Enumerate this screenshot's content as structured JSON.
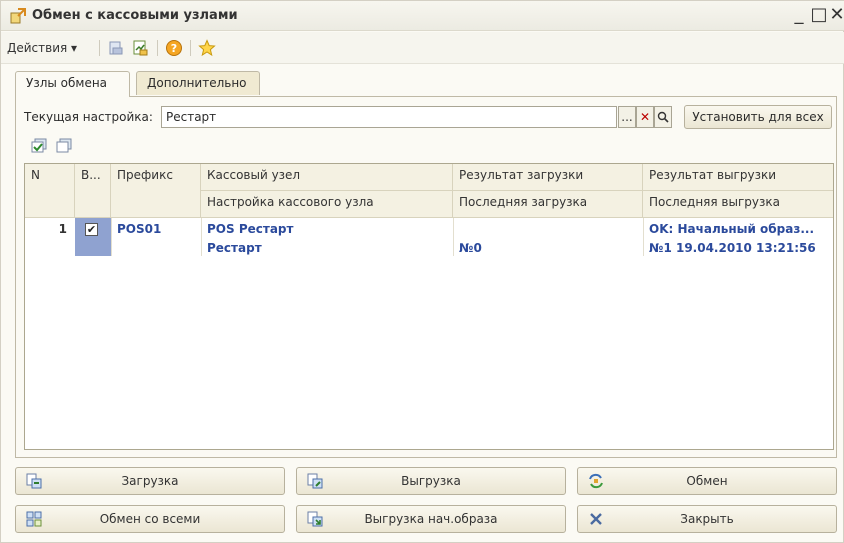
{
  "window": {
    "title": "Обмен с кассовыми узлами"
  },
  "toolbar": {
    "actions_label": "Действия ▾"
  },
  "tabs": [
    {
      "label": "Узлы обмена"
    },
    {
      "label": "Дополнительно"
    }
  ],
  "setting": {
    "label": "Текущая настройка:",
    "value": "Рестарт",
    "ellipsis_label": "...",
    "set_all_label": "Установить для всех"
  },
  "table": {
    "headers": {
      "n": "N",
      "flag": "В...",
      "prefix": "Префикс",
      "node": "Кассовый узел",
      "node_setting": "Настройка кассового узла",
      "load_result": "Результат загрузки",
      "last_load": "Последняя загрузка",
      "unload_result": "Результат выгрузки",
      "last_unload": "Последняя выгрузка"
    },
    "rows": [
      {
        "n": "1",
        "checked": true,
        "prefix": "POS01",
        "node": "POS Рестарт",
        "node_setting": "Рестарт",
        "load_result": "",
        "last_load": "№0",
        "unload_result": "OK: Начальный образ...",
        "last_unload": "№1 19.04.2010 13:21:56"
      }
    ]
  },
  "buttons": {
    "load": "Загрузка",
    "unload": "Выгрузка",
    "exchange": "Обмен",
    "exchange_all": "Обмен со всеми",
    "unload_initial": "Выгрузка нач.образа",
    "close": "Закрыть"
  },
  "colors": {
    "accent_text": "#2b4a9c",
    "selection": "#8fa2d0",
    "header_bg": "#f4f1e2"
  }
}
